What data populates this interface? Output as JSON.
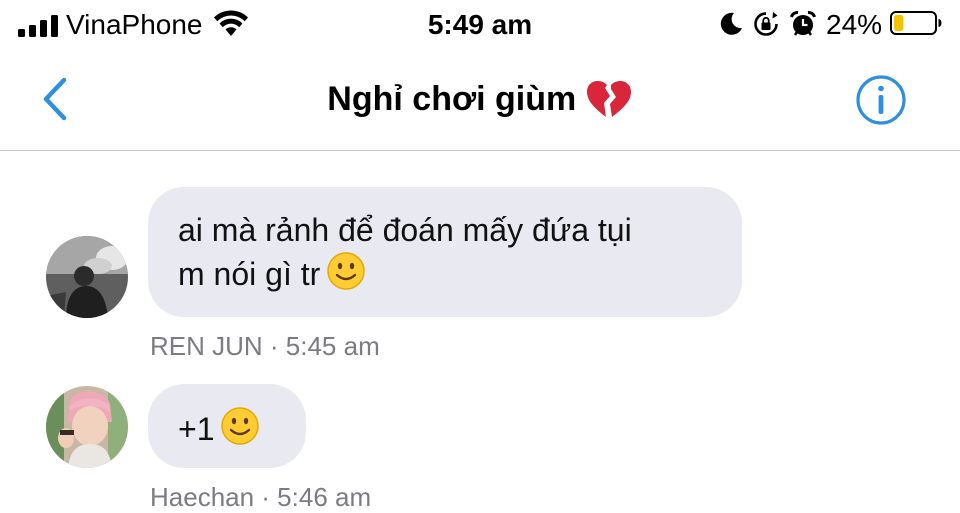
{
  "status_bar": {
    "carrier": "VinaPhone",
    "time": "5:49 am",
    "battery_percent": "24%",
    "battery_level": 0.24,
    "battery_color": "#f5c400"
  },
  "header": {
    "title": "Nghỉ chơi giùm",
    "title_emoji": "broken-heart",
    "accent_color": "#2e8fe0"
  },
  "messages": [
    {
      "text": "ai mà rảnh để đoán mấy đứa tụi\nm nói gì tr",
      "emoji": "slightly-smiling-face",
      "sender": "REN JUN",
      "separator": "·",
      "time": "5:45 am",
      "meta": "REN JUN · 5:45 am"
    },
    {
      "text": "+1",
      "emoji": "slightly-smiling-face",
      "sender": "Haechan",
      "separator": "·",
      "time": "5:46 am",
      "meta": "Haechan · 5:46 am"
    }
  ]
}
